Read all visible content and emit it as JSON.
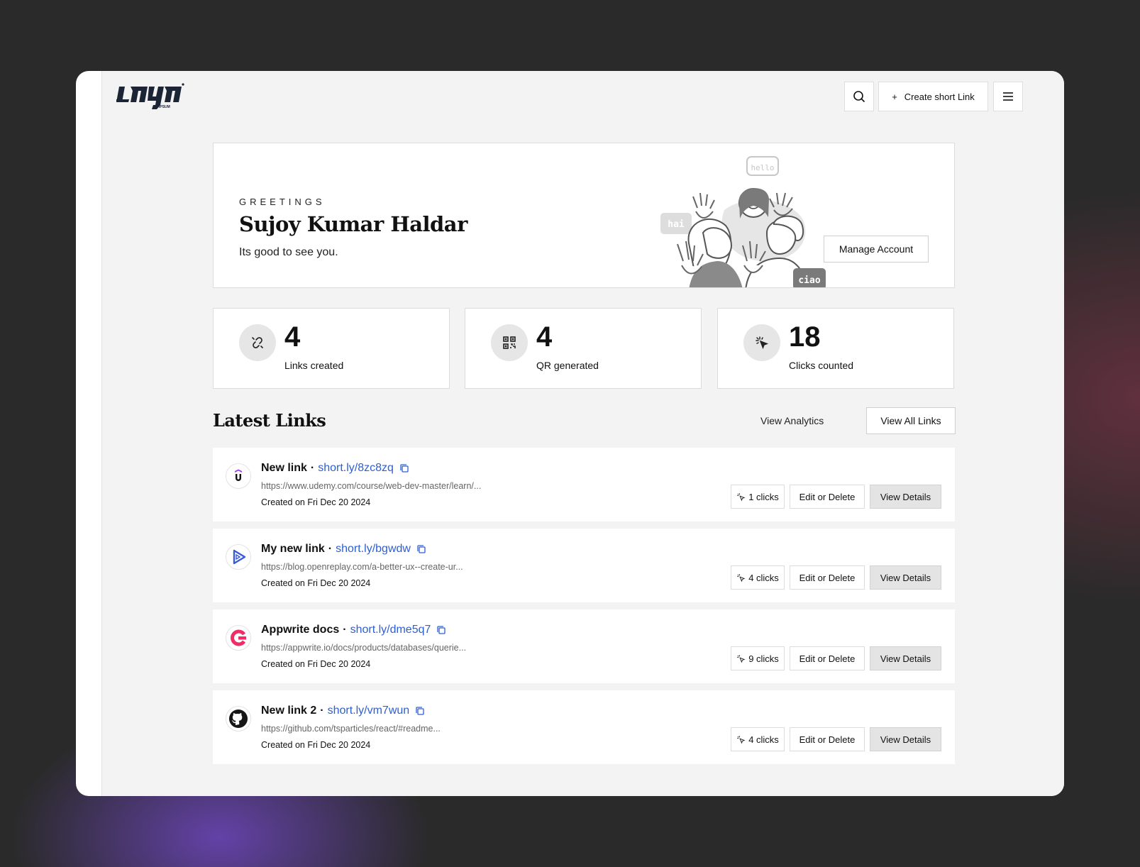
{
  "header": {
    "create_label": "Create short Link",
    "create_prefix": "+"
  },
  "greeting": {
    "label": "GREETINGS",
    "name": "Sujoy Kumar Haldar",
    "subtitle": "Its good to see you.",
    "manage_label": "Manage Account",
    "bubbles": [
      "hello",
      "hai",
      "ciao"
    ]
  },
  "stats": [
    {
      "value": "4",
      "label": "Links created",
      "icon": "link-broken-icon"
    },
    {
      "value": "4",
      "label": "QR generated",
      "icon": "qr-code-icon"
    },
    {
      "value": "18",
      "label": "Clicks counted",
      "icon": "cursor-click-icon"
    }
  ],
  "latest": {
    "title": "Latest Links",
    "analytics_label": "View Analytics",
    "view_all_label": "View All Links",
    "edit_label": "Edit or Delete",
    "details_label": "View Details",
    "links": [
      {
        "name": "New link",
        "short": "short.ly/8zc8zq",
        "url": "https://www.udemy.com/course/web-dev-master/learn/...",
        "created": "Created on Fri Dec 20 2024",
        "clicks": "1 clicks",
        "icon": "udemy-icon"
      },
      {
        "name": "My new link",
        "short": "short.ly/bgwdw",
        "url": "https://blog.openreplay.com/a-better-ux--create-ur...",
        "created": "Created on Fri Dec 20 2024",
        "clicks": "4 clicks",
        "icon": "openreplay-icon"
      },
      {
        "name": "Appwrite docs",
        "short": "short.ly/dme5q7",
        "url": "https://appwrite.io/docs/products/databases/querie...",
        "created": "Created on Fri Dec 20 2024",
        "clicks": "9 clicks",
        "icon": "appwrite-icon"
      },
      {
        "name": "New link 2",
        "short": "short.ly/vm7wun",
        "url": "https://github.com/tsparticles/react/#readme...",
        "created": "Created on Fri Dec 20 2024",
        "clicks": "4 clicks",
        "icon": "github-icon"
      }
    ]
  },
  "colors": {
    "link_blue": "#2d5fd0",
    "panel_bg": "#f3f3f3",
    "appwrite_pink": "#f02e65",
    "openreplay_blue": "#3a5bd9"
  }
}
